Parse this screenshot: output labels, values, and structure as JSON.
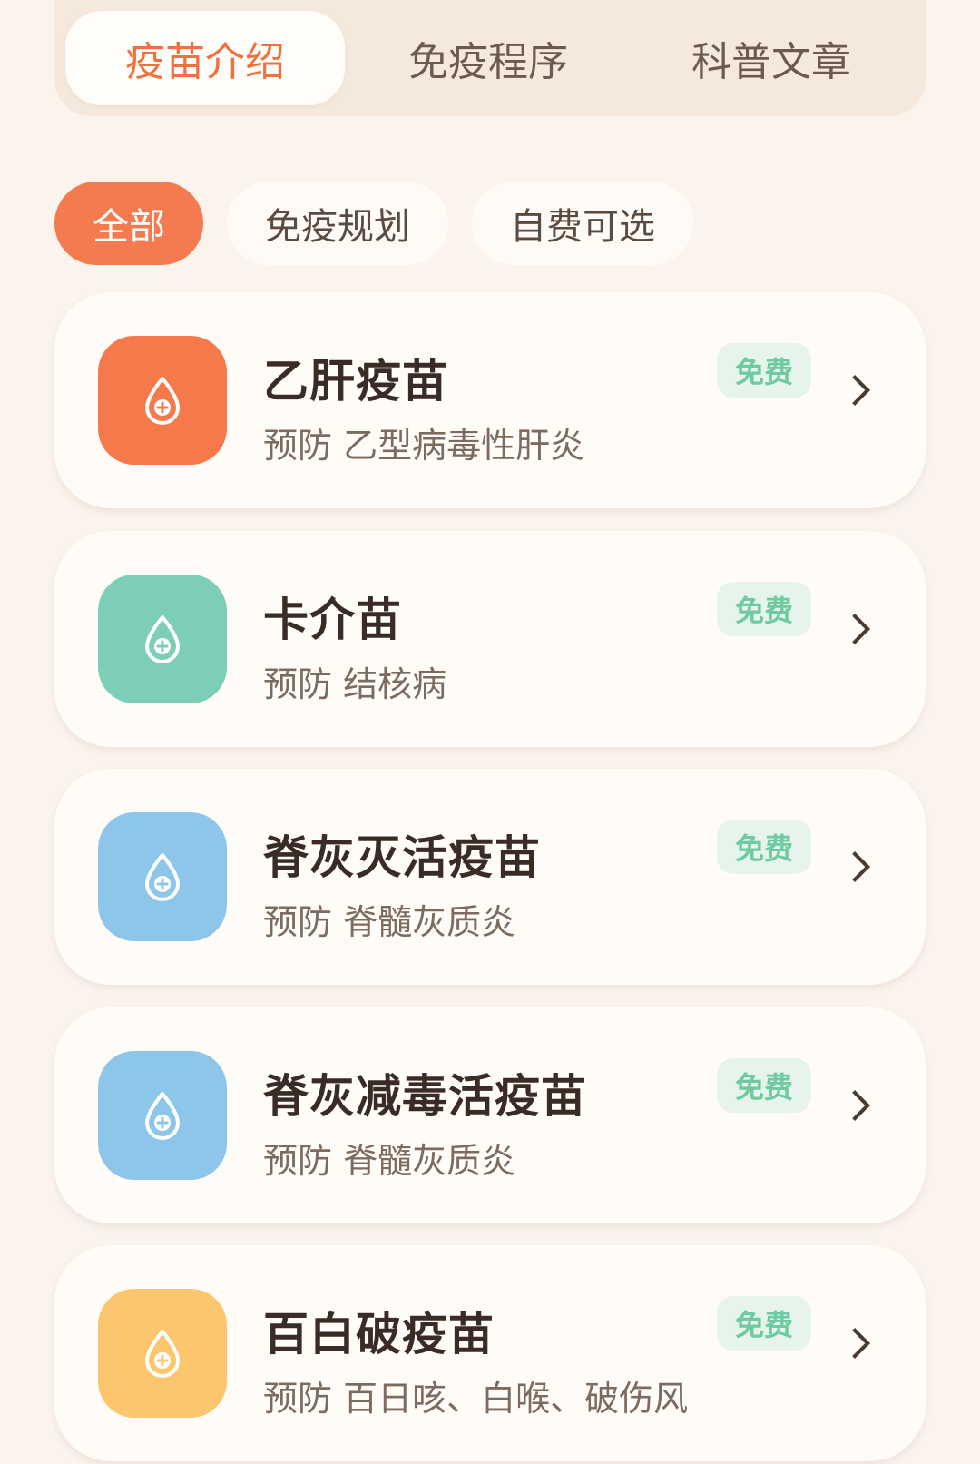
{
  "tabs": [
    {
      "label": "疫苗介绍",
      "active": true
    },
    {
      "label": "免疫程序",
      "active": false
    },
    {
      "label": "科普文章",
      "active": false
    }
  ],
  "filters": [
    {
      "label": "全部",
      "active": true
    },
    {
      "label": "免疫规划",
      "active": false
    },
    {
      "label": "自费可选",
      "active": false
    }
  ],
  "vaccines": [
    {
      "name": "乙肝疫苗",
      "desc": "预防 乙型病毒性肝炎",
      "badge": "免费",
      "color": "#f5794a",
      "icon": "drop-plus-icon"
    },
    {
      "name": "卡介苗",
      "desc": "预防 结核病",
      "badge": "免费",
      "color": "#7ccfb6",
      "icon": "drop-plus-icon"
    },
    {
      "name": "脊灰灭活疫苗",
      "desc": "预防 脊髓灰质炎",
      "badge": "免费",
      "color": "#8ec6ea",
      "icon": "drop-plus-icon"
    },
    {
      "name": "脊灰减毒活疫苗",
      "desc": "预防 脊髓灰质炎",
      "badge": "免费",
      "color": "#8ec6ea",
      "icon": "drop-plus-icon"
    },
    {
      "name": "百白破疫苗",
      "desc": "预防 百日咳、白喉、破伤风",
      "badge": "免费",
      "color": "#fcc66f",
      "icon": "drop-plus-icon"
    }
  ]
}
